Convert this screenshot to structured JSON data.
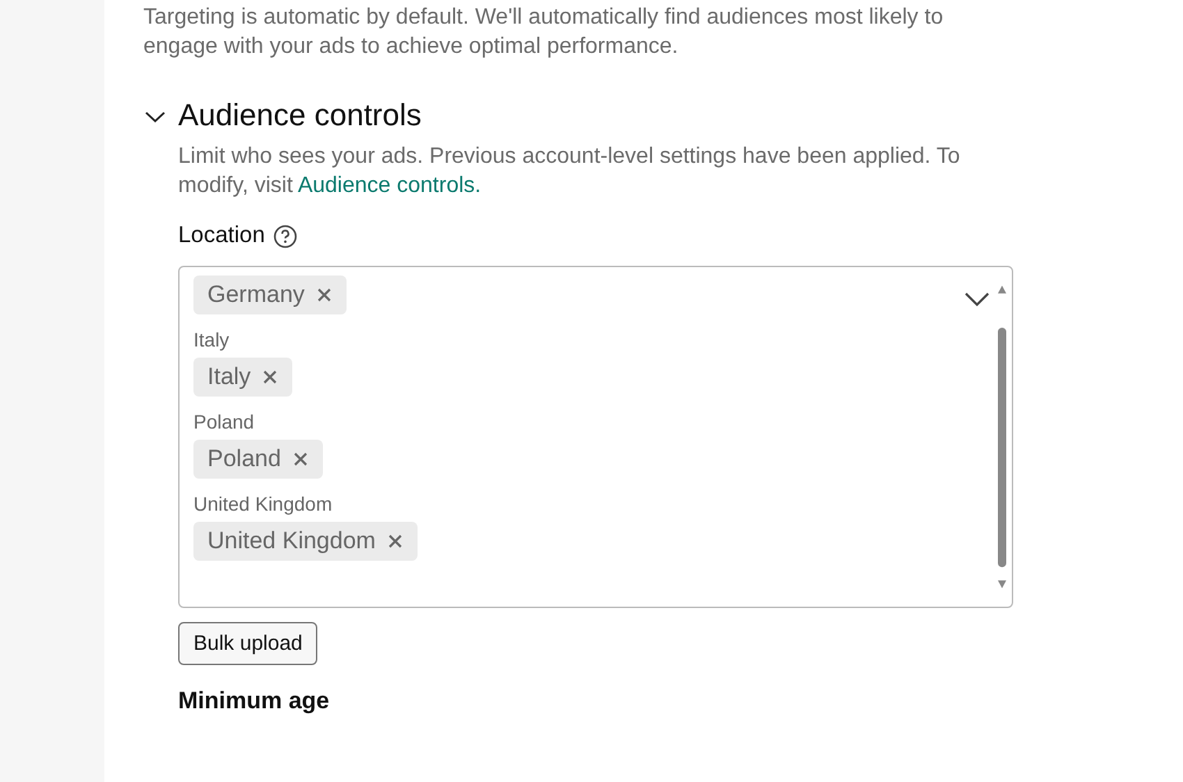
{
  "intro": "Targeting is automatic by default. We'll automatically find audiences most likely to engage with your ads to achieve optimal performance.",
  "section": {
    "title": "Audience controls",
    "expanded": true,
    "description": "Limit who sees your ads. Previous account-level settings have been applied. To modify, visit ",
    "link": "Audience controls."
  },
  "location": {
    "label": "Location",
    "groups": [
      {
        "tags": [
          "Germany"
        ]
      },
      {
        "label": "Italy",
        "tags": [
          "Italy"
        ]
      },
      {
        "label": "Poland",
        "tags": [
          "Poland"
        ]
      },
      {
        "label": "United Kingdom",
        "tags": [
          "United Kingdom"
        ]
      }
    ]
  },
  "bulk_button": "Bulk upload",
  "next_heading": "Minimum age"
}
